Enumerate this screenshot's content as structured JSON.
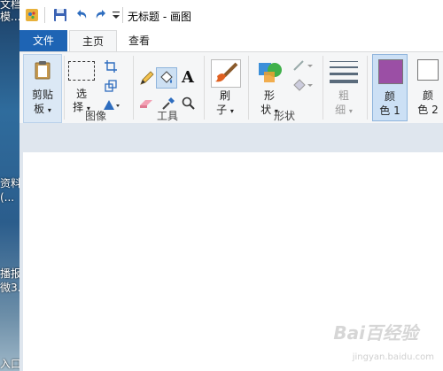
{
  "desktop": {
    "items": [
      "文档",
      "模...",
      "资料",
      "(...",
      "播报",
      "微3...",
      "入口"
    ]
  },
  "titlebar": {
    "title": "无标题 - 画图"
  },
  "tabs": {
    "file": "文件",
    "home": "主页",
    "view": "查看"
  },
  "ribbon": {
    "clipboard": {
      "label1": "剪贴",
      "label2": "板"
    },
    "select": {
      "label1": "选",
      "label2": "择"
    },
    "brush": {
      "label1": "刷",
      "label2": "子"
    },
    "shapes": {
      "label1": "形",
      "label2": "状"
    },
    "size": {
      "label1": "粗",
      "label2": "细"
    },
    "color1": {
      "label1": "颜",
      "label2": "色 1"
    },
    "color2": {
      "label1": "颜",
      "label2": "色 2"
    },
    "groups": {
      "image": "图像",
      "tools": "工具",
      "shapes": "形状"
    },
    "text_tool": "A"
  },
  "colors": {
    "color1": "#9b4fa5",
    "color2": "#ffffff",
    "accent": "#1e64b4"
  },
  "watermark": {
    "main": "Bai百经验",
    "sub": "jingyan.baidu.com"
  }
}
